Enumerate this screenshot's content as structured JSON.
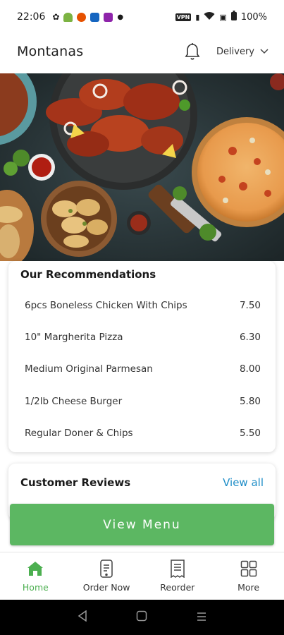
{
  "status_bar": {
    "time": "22:06",
    "vpn_label": "VPN",
    "battery": "100%"
  },
  "header": {
    "brand": "Montanas",
    "delivery_label": "Delivery"
  },
  "recommendations": {
    "title": "Our Recommendations",
    "items": [
      {
        "name": "6pcs Boneless Chicken With Chips",
        "price": "7.50"
      },
      {
        "name": "10\" Margherita Pizza",
        "price": "6.30"
      },
      {
        "name": "Medium Original Parmesan",
        "price": "8.00"
      },
      {
        "name": "1/2lb Cheese Burger",
        "price": "5.80"
      },
      {
        "name": "Regular Doner & Chips",
        "price": "5.50"
      }
    ]
  },
  "reviews": {
    "title": "Customer Reviews",
    "view_all": "View all"
  },
  "view_menu_label": "View Menu",
  "bottom_nav": [
    {
      "label": "Home",
      "icon": "home-icon",
      "active": true
    },
    {
      "label": "Order Now",
      "icon": "phone-order-icon",
      "active": false
    },
    {
      "label": "Reorder",
      "icon": "receipt-icon",
      "active": false
    },
    {
      "label": "More",
      "icon": "grid-icon",
      "active": false
    }
  ],
  "colors": {
    "accent": "#5cb762",
    "link": "#1d8dc7",
    "active_nav": "#4caf50"
  }
}
